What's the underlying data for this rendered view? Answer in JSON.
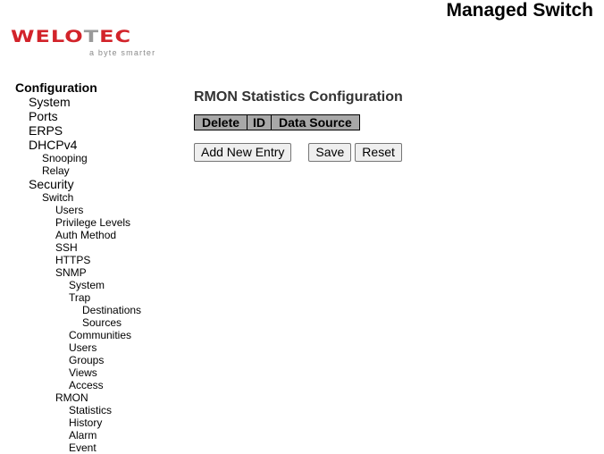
{
  "header": {
    "product_title": "Managed Switch",
    "logo": {
      "brand_red": "WELO",
      "brand_grey": "T",
      "brand_red_end": "EC",
      "tagline": "a byte smarter",
      "brand_color": "#d2232a"
    }
  },
  "nav": {
    "root": "Configuration",
    "items": [
      {
        "label": "System",
        "level": 1
      },
      {
        "label": "Ports",
        "level": 1
      },
      {
        "label": "ERPS",
        "level": 1
      },
      {
        "label": "DHCPv4",
        "level": 1
      },
      {
        "label": "Snooping",
        "level": 2
      },
      {
        "label": "Relay",
        "level": 2
      },
      {
        "label": "Security",
        "level": 1
      },
      {
        "label": "Switch",
        "level": 2
      },
      {
        "label": "Users",
        "level": 3
      },
      {
        "label": "Privilege Levels",
        "level": 3
      },
      {
        "label": "Auth Method",
        "level": 3
      },
      {
        "label": "SSH",
        "level": 3
      },
      {
        "label": "HTTPS",
        "level": 3
      },
      {
        "label": "SNMP",
        "level": 3
      },
      {
        "label": "System",
        "level": 4
      },
      {
        "label": "Trap",
        "level": 4
      },
      {
        "label": "Destinations",
        "level": 5
      },
      {
        "label": "Sources",
        "level": 5
      },
      {
        "label": "Communities",
        "level": 4
      },
      {
        "label": "Users",
        "level": 4
      },
      {
        "label": "Groups",
        "level": 4
      },
      {
        "label": "Views",
        "level": 4
      },
      {
        "label": "Access",
        "level": 4
      },
      {
        "label": "RMON",
        "level": 3
      },
      {
        "label": "Statistics",
        "level": 4
      },
      {
        "label": "History",
        "level": 4
      },
      {
        "label": "Alarm",
        "level": 4
      },
      {
        "label": "Event",
        "level": 4
      }
    ]
  },
  "main": {
    "title": "RMON Statistics Configuration",
    "table": {
      "columns": [
        "Delete",
        "ID",
        "Data Source"
      ],
      "rows": [],
      "header_color": "#a8a8a8"
    },
    "buttons": {
      "add_new_entry": "Add New Entry",
      "save": "Save",
      "reset": "Reset"
    }
  }
}
